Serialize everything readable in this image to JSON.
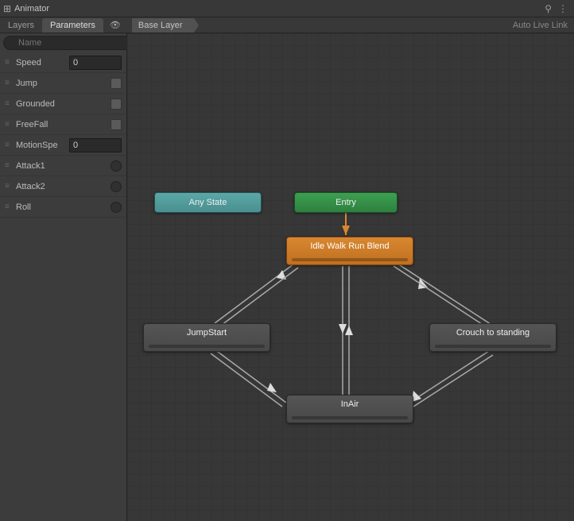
{
  "window": {
    "title": "Animator",
    "lock_icon": "lock-open-icon",
    "menu_icon": "kebab-menu-icon"
  },
  "tabs": {
    "layers": "Layers",
    "parameters": "Parameters",
    "active": "parameters"
  },
  "breadcrumb": {
    "base": "Base Layer"
  },
  "toolbar": {
    "auto_live_link": "Auto Live Link"
  },
  "search": {
    "placeholder": "Name",
    "add_label": "+"
  },
  "parameters": [
    {
      "name": "Speed",
      "type": "float",
      "value": "0"
    },
    {
      "name": "Jump",
      "type": "bool",
      "value": false
    },
    {
      "name": "Grounded",
      "type": "bool",
      "value": false
    },
    {
      "name": "FreeFall",
      "type": "bool",
      "value": false
    },
    {
      "name": "MotionSpe",
      "type": "float",
      "value": "0"
    },
    {
      "name": "Attack1",
      "type": "trigger",
      "value": false
    },
    {
      "name": "Attack2",
      "type": "trigger",
      "value": false
    },
    {
      "name": "Roll",
      "type": "trigger",
      "value": false
    }
  ],
  "nodes": {
    "any_state": "Any State",
    "entry": "Entry",
    "idle_blend": "Idle Walk Run Blend",
    "jump_start": "JumpStart",
    "crouch": "Crouch to standing",
    "in_air": "InAir"
  }
}
